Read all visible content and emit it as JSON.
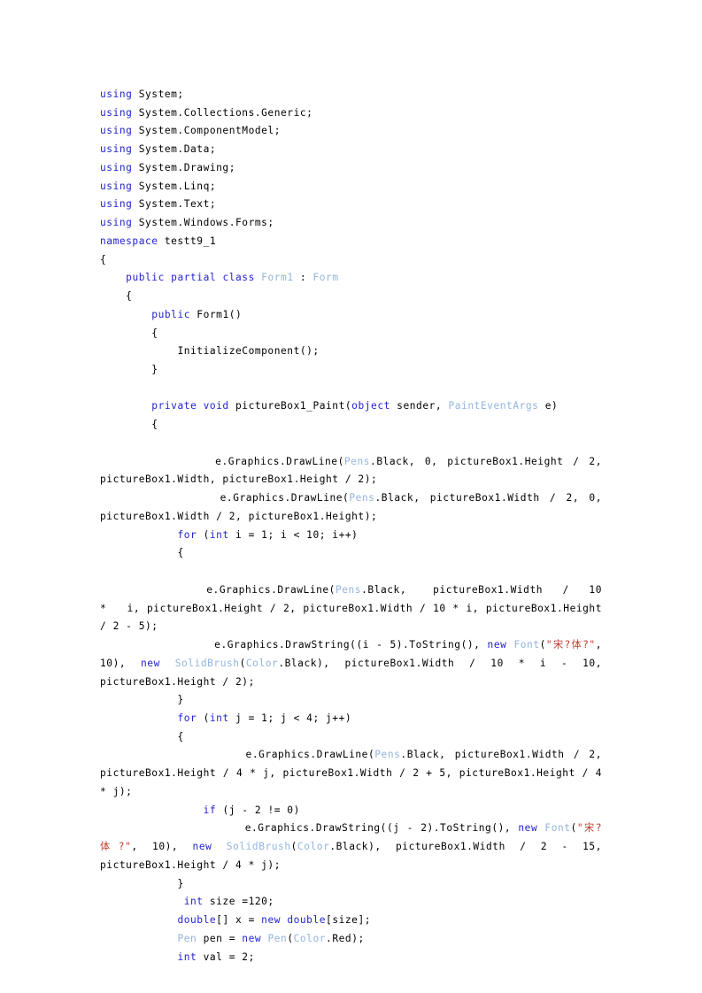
{
  "document": {
    "kind": "source-code-listing",
    "language": "csharp",
    "background_color": "#ffffff",
    "colors": {
      "keyword": "#2323cf",
      "type": "#93b4dd",
      "string": "#c0392b",
      "plain": "#000000"
    },
    "lines": [
      {
        "id": "line-1",
        "tokens": [
          {
            "t": "using",
            "c": "kw"
          },
          {
            "t": " System;",
            "c": "pl"
          }
        ]
      },
      {
        "id": "line-2",
        "tokens": [
          {
            "t": "using",
            "c": "kw"
          },
          {
            "t": " System.Collections.Generic;",
            "c": "pl"
          }
        ]
      },
      {
        "id": "line-3",
        "tokens": [
          {
            "t": "using",
            "c": "kw"
          },
          {
            "t": " System.ComponentModel;",
            "c": "pl"
          }
        ]
      },
      {
        "id": "line-4",
        "tokens": [
          {
            "t": "using",
            "c": "kw"
          },
          {
            "t": " System.Data;",
            "c": "pl"
          }
        ]
      },
      {
        "id": "line-5",
        "tokens": [
          {
            "t": "using",
            "c": "kw"
          },
          {
            "t": " System.Drawing;",
            "c": "pl"
          }
        ]
      },
      {
        "id": "line-6",
        "tokens": [
          {
            "t": "using",
            "c": "kw"
          },
          {
            "t": " System.Linq;",
            "c": "pl"
          }
        ]
      },
      {
        "id": "line-7",
        "tokens": [
          {
            "t": "using",
            "c": "kw"
          },
          {
            "t": " System.Text;",
            "c": "pl"
          }
        ]
      },
      {
        "id": "line-8",
        "tokens": [
          {
            "t": "using",
            "c": "kw"
          },
          {
            "t": " System.Windows.Forms;",
            "c": "pl"
          }
        ]
      },
      {
        "id": "line-9",
        "tokens": [
          {
            "t": "namespace",
            "c": "kw"
          },
          {
            "t": " testt9_1",
            "c": "pl"
          }
        ]
      },
      {
        "id": "line-10",
        "tokens": [
          {
            "t": "{",
            "c": "pl"
          }
        ]
      },
      {
        "id": "line-11",
        "tokens": [
          {
            "t": "    ",
            "c": "pl"
          },
          {
            "t": "public partial class",
            "c": "kw"
          },
          {
            "t": " ",
            "c": "pl"
          },
          {
            "t": "Form1",
            "c": "typ"
          },
          {
            "t": " : ",
            "c": "pl"
          },
          {
            "t": "Form",
            "c": "typ"
          }
        ]
      },
      {
        "id": "line-12",
        "tokens": [
          {
            "t": "    {",
            "c": "pl"
          }
        ]
      },
      {
        "id": "line-13",
        "tokens": [
          {
            "t": "        ",
            "c": "pl"
          },
          {
            "t": "public",
            "c": "kw"
          },
          {
            "t": " Form1()",
            "c": "pl"
          }
        ]
      },
      {
        "id": "line-14",
        "tokens": [
          {
            "t": "        {",
            "c": "pl"
          }
        ]
      },
      {
        "id": "line-15",
        "tokens": [
          {
            "t": "            InitializeComponent();",
            "c": "pl"
          }
        ]
      },
      {
        "id": "line-16",
        "tokens": [
          {
            "t": "        }",
            "c": "pl"
          }
        ]
      },
      {
        "id": "line-17",
        "tokens": [
          {
            "t": "",
            "c": "pl"
          }
        ]
      },
      {
        "id": "line-18",
        "tokens": [
          {
            "t": "        ",
            "c": "pl"
          },
          {
            "t": "private void",
            "c": "kw"
          },
          {
            "t": " pictureBox1_Paint(",
            "c": "pl"
          },
          {
            "t": "object",
            "c": "kw"
          },
          {
            "t": " sender, ",
            "c": "pl"
          },
          {
            "t": "PaintEventArgs",
            "c": "typ"
          },
          {
            "t": " e)",
            "c": "pl"
          }
        ]
      },
      {
        "id": "line-19",
        "tokens": [
          {
            "t": "        {",
            "c": "pl"
          }
        ]
      },
      {
        "id": "line-20",
        "tokens": [
          {
            "t": "",
            "c": "pl"
          }
        ]
      },
      {
        "id": "line-21",
        "tokens": [
          {
            "t": "            e.Graphics.DrawLine(",
            "c": "pl"
          },
          {
            "t": "Pens",
            "c": "typ"
          },
          {
            "t": ".Black, 0, pictureBox1.Height / 2, pictureBox1.Width, pictureBox1.Height / 2);",
            "c": "pl"
          }
        ]
      },
      {
        "id": "line-22",
        "tokens": [
          {
            "t": "            e.Graphics.DrawLine(",
            "c": "pl"
          },
          {
            "t": "Pens",
            "c": "typ"
          },
          {
            "t": ".Black, pictureBox1.Width / 2, 0, pictureBox1.Width / 2, pictureBox1.Height);",
            "c": "pl"
          }
        ]
      },
      {
        "id": "line-23",
        "tokens": [
          {
            "t": "            ",
            "c": "pl"
          },
          {
            "t": "for",
            "c": "kw"
          },
          {
            "t": " (",
            "c": "pl"
          },
          {
            "t": "int",
            "c": "kw"
          },
          {
            "t": " i = 1; i < 10; i++)",
            "c": "pl"
          }
        ]
      },
      {
        "id": "line-24",
        "tokens": [
          {
            "t": "            {",
            "c": "pl"
          }
        ]
      },
      {
        "id": "line-25",
        "tokens": [
          {
            "t": "",
            "c": "pl"
          }
        ]
      },
      {
        "id": "line-26",
        "tokens": [
          {
            "t": "                e.Graphics.DrawLine(",
            "c": "pl"
          },
          {
            "t": "Pens",
            "c": "typ"
          },
          {
            "t": ".Black,    pictureBox1.Width   /   10   *   i, pictureBox1.Height / 2, pictureBox1.Width / 10 * i, pictureBox1.Height / 2 - 5);",
            "c": "pl"
          }
        ]
      },
      {
        "id": "line-27",
        "tokens": [
          {
            "t": "                e.Graphics.DrawString((i - 5).ToString(), ",
            "c": "pl"
          },
          {
            "t": "new",
            "c": "kw"
          },
          {
            "t": " ",
            "c": "pl"
          },
          {
            "t": "Font",
            "c": "typ"
          },
          {
            "t": "(",
            "c": "pl"
          },
          {
            "t": "\"宋?体?\"",
            "c": "str"
          },
          {
            "t": ", 10), ",
            "c": "pl"
          },
          {
            "t": "new",
            "c": "kw"
          },
          {
            "t": " ",
            "c": "pl"
          },
          {
            "t": "SolidBrush",
            "c": "typ"
          },
          {
            "t": "(",
            "c": "pl"
          },
          {
            "t": "Color",
            "c": "typ"
          },
          {
            "t": ".Black), pictureBox1.Width / 10 * i - 10, pictureBox1.Height / 2);",
            "c": "pl"
          }
        ]
      },
      {
        "id": "line-28",
        "tokens": [
          {
            "t": "            }",
            "c": "pl"
          }
        ]
      },
      {
        "id": "line-29",
        "tokens": [
          {
            "t": "            ",
            "c": "pl"
          },
          {
            "t": "for",
            "c": "kw"
          },
          {
            "t": " (",
            "c": "pl"
          },
          {
            "t": "int",
            "c": "kw"
          },
          {
            "t": " j = 1; j < 4; j++)",
            "c": "pl"
          }
        ]
      },
      {
        "id": "line-30",
        "tokens": [
          {
            "t": "            {",
            "c": "pl"
          }
        ]
      },
      {
        "id": "line-31",
        "tokens": [
          {
            "t": "                e.Graphics.DrawLine(",
            "c": "pl"
          },
          {
            "t": "Pens",
            "c": "typ"
          },
          {
            "t": ".Black, pictureBox1.Width / 2, pictureBox1.Height / 4 * j, pictureBox1.Width / 2 + 5, pictureBox1.Height / 4 * j);",
            "c": "pl"
          }
        ]
      },
      {
        "id": "line-32",
        "tokens": [
          {
            "t": "                ",
            "c": "pl"
          },
          {
            "t": "if",
            "c": "kw"
          },
          {
            "t": " (j - 2 != 0)",
            "c": "pl"
          }
        ]
      },
      {
        "id": "line-33",
        "tokens": [
          {
            "t": "                    e.Graphics.DrawString((j - 2).ToString(), ",
            "c": "pl"
          },
          {
            "t": "new",
            "c": "kw"
          },
          {
            "t": " ",
            "c": "pl"
          },
          {
            "t": "Font",
            "c": "typ"
          },
          {
            "t": "(",
            "c": "pl"
          },
          {
            "t": "\"宋?体?\"",
            "c": "str"
          },
          {
            "t": ", 10), ",
            "c": "pl"
          },
          {
            "t": "new",
            "c": "kw"
          },
          {
            "t": " ",
            "c": "pl"
          },
          {
            "t": "SolidBrush",
            "c": "typ"
          },
          {
            "t": "(",
            "c": "pl"
          },
          {
            "t": "Color",
            "c": "typ"
          },
          {
            "t": ".Black), pictureBox1.Width / 2 - 15, pictureBox1.Height / 4 * j);",
            "c": "pl"
          }
        ]
      },
      {
        "id": "line-34",
        "tokens": [
          {
            "t": "            }",
            "c": "pl"
          }
        ]
      },
      {
        "id": "line-35",
        "tokens": [
          {
            "t": "             ",
            "c": "pl"
          },
          {
            "t": "int",
            "c": "kw"
          },
          {
            "t": " size =120;",
            "c": "pl"
          }
        ]
      },
      {
        "id": "line-36",
        "tokens": [
          {
            "t": "            ",
            "c": "pl"
          },
          {
            "t": "double",
            "c": "kw"
          },
          {
            "t": "[] x = ",
            "c": "pl"
          },
          {
            "t": "new",
            "c": "kw"
          },
          {
            "t": " ",
            "c": "pl"
          },
          {
            "t": "double",
            "c": "kw"
          },
          {
            "t": "[size];",
            "c": "pl"
          }
        ]
      },
      {
        "id": "line-37",
        "tokens": [
          {
            "t": "            ",
            "c": "pl"
          },
          {
            "t": "Pen",
            "c": "typ"
          },
          {
            "t": " pen = ",
            "c": "pl"
          },
          {
            "t": "new",
            "c": "kw"
          },
          {
            "t": " ",
            "c": "pl"
          },
          {
            "t": "Pen",
            "c": "typ"
          },
          {
            "t": "(",
            "c": "pl"
          },
          {
            "t": "Color",
            "c": "typ"
          },
          {
            "t": ".Red);",
            "c": "pl"
          }
        ]
      },
      {
        "id": "line-38",
        "tokens": [
          {
            "t": "            ",
            "c": "pl"
          },
          {
            "t": "int",
            "c": "kw"
          },
          {
            "t": " val = 2;",
            "c": "pl"
          }
        ]
      }
    ]
  }
}
